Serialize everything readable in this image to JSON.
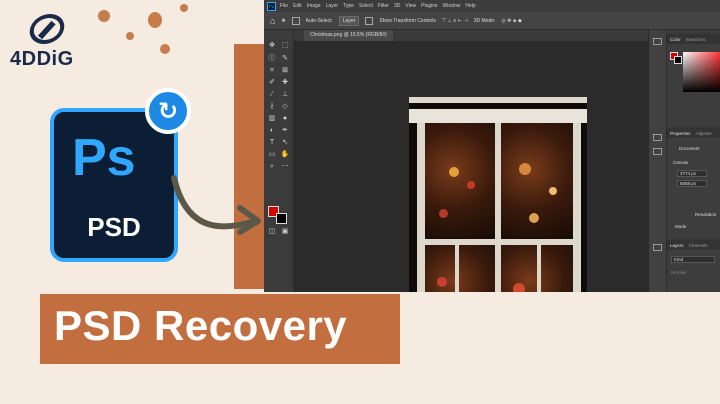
{
  "brand": {
    "logo_text": "4DDiG"
  },
  "hero": {
    "app_icon_text": "Ps",
    "file_label": "PSD",
    "title": "PSD Recovery"
  },
  "photoshop": {
    "badge": "Ps",
    "menu": [
      "File",
      "Edit",
      "Image",
      "Layer",
      "Type",
      "Select",
      "Filter",
      "3D",
      "View",
      "Plugins",
      "Window",
      "Help"
    ],
    "options": {
      "auto_select_label": "Auto-Select:",
      "auto_select_value": "Layer",
      "transform_label": "Show Transform Controls",
      "mode_3d": "3D Mode:"
    },
    "document_tab": "Christmas.png @ 15.5% (RGB/8#)",
    "panels": {
      "color_tab": "Color",
      "swatches_tab": "Swatches",
      "properties_tab": "Properties",
      "adjustments_tab": "Adjustm",
      "document_label": "Document",
      "canvas_label": "Canvas",
      "width_value": "3774 px",
      "height_value": "5658 px",
      "resolution_label": "Resolution",
      "mode_label": "Mode",
      "layers_tab": "Layers",
      "channels_tab": "Channels",
      "kind_label": "Kind",
      "normal_label": "Normal",
      "layer_name": "Layer 1"
    },
    "colors": {
      "foreground": "#d40000",
      "background": "#000000",
      "accent": "#31a8ff"
    }
  }
}
